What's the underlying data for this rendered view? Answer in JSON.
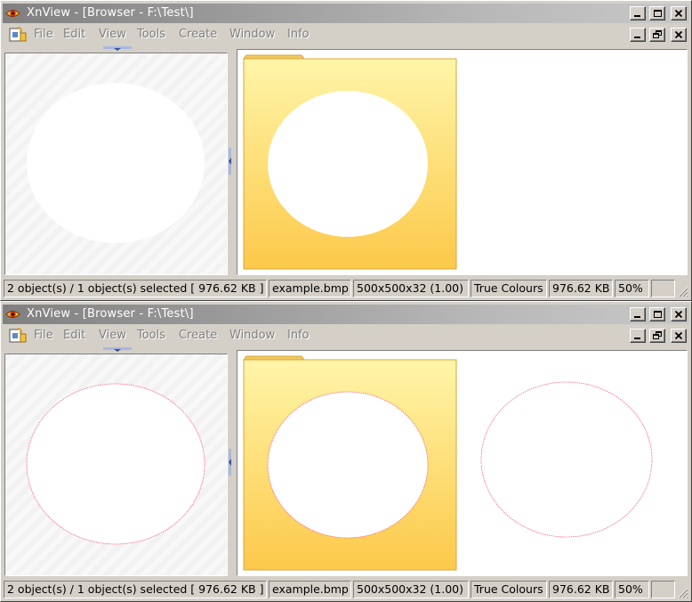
{
  "windows": [
    {
      "id": "w1",
      "title": "XnView - [Browser - F:\\Test\\]",
      "menu": [
        "File",
        "Edit",
        "View",
        "Tools",
        "Create",
        "Window",
        "Info"
      ],
      "status": [
        "2 object(s) / 1 object(s) selected  [ 976.62 KB ]",
        "example.bmp",
        "500x500x32 (1.00)",
        "True Colours",
        "976.62 KB",
        "50%",
        ""
      ]
    },
    {
      "id": "w2",
      "title": "XnView - [Browser - F:\\Test\\]",
      "menu": [
        "File",
        "Edit",
        "View",
        "Tools",
        "Create",
        "Window",
        "Info"
      ],
      "status": [
        "2 object(s) / 1 object(s) selected  [ 976.62 KB ]",
        "example.bmp",
        "500x500x32 (1.00)",
        "True Colours",
        "976.62 KB",
        "50%",
        ""
      ]
    }
  ],
  "colors": {
    "titlebar_start": "#808080",
    "titlebar_end": "#c8c8c8",
    "folder_top": "#fff5a8",
    "folder_bottom": "#fcc94a",
    "folder_border": "#d8a63c",
    "circle_outline_pink": "#ff6080"
  },
  "icons": {
    "app": "xnview-eye-icon",
    "menu_doc": "document-icon",
    "minimize": "minimize-icon",
    "maximize": "maximize-icon",
    "restore": "restore-icon",
    "close": "close-icon"
  }
}
